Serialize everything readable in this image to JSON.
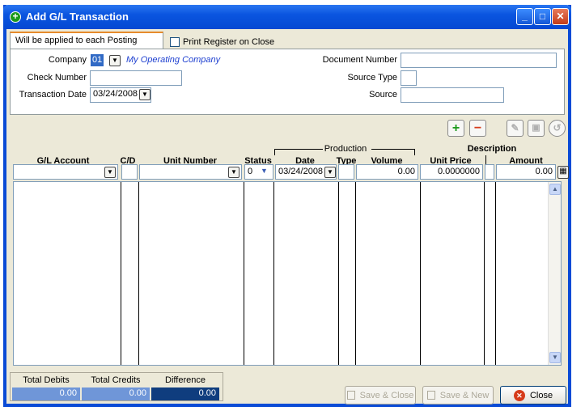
{
  "window": {
    "title": "Add G/L Transaction"
  },
  "tabs": {
    "active": "Will be applied to each Posting"
  },
  "print_register": {
    "label": "Print Register on Close",
    "checked": false
  },
  "header_form": {
    "company_label": "Company",
    "company_code": "01",
    "company_name": "My Operating Company",
    "check_number_label": "Check Number",
    "check_number": "",
    "transaction_date_label": "Transaction Date",
    "transaction_date": "03/24/2008",
    "document_number_label": "Document Number",
    "document_number": "",
    "source_type_label": "Source Type",
    "source_type": "",
    "source_label": "Source",
    "source": ""
  },
  "grid": {
    "production_label": "Production",
    "columns": [
      "G/L Account",
      "C/D",
      "Unit Number",
      "Status",
      "Date",
      "Type",
      "Volume",
      "Unit Price",
      "Description",
      "Amount"
    ],
    "entry_row": {
      "gl_account": "",
      "cd": "",
      "unit_number": "",
      "status": "0",
      "date": "03/24/2008",
      "type": "",
      "volume": "0.00",
      "unit_price": "0.0000000",
      "description": "",
      "amount": "0.00"
    }
  },
  "totals": {
    "debits_label": "Total Debits",
    "credits_label": "Total Credits",
    "difference_label": "Difference",
    "debits": "0.00",
    "credits": "0.00",
    "difference": "0.00"
  },
  "buttons": {
    "save_close": "Save & Close",
    "save_new": "Save & New",
    "close": "Close"
  },
  "colors": {
    "title_bar": "#0a55e0",
    "totals_field": "#6f96d8",
    "difference_field": "#0f3d7e",
    "add_green": "#1b9a1b",
    "remove_red": "#d63b1b"
  }
}
